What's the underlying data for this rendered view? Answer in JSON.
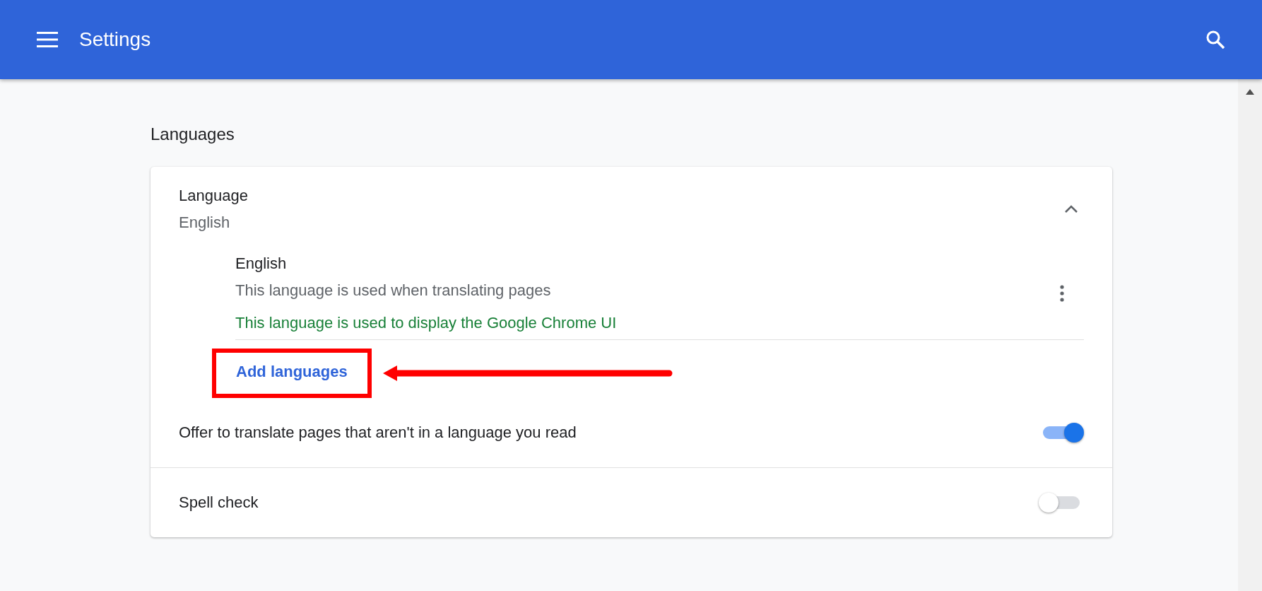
{
  "header": {
    "title": "Settings"
  },
  "section_title": "Languages",
  "language": {
    "label": "Language",
    "value": "English",
    "expanded": true,
    "items": [
      {
        "name": "English",
        "lines": [
          "This language is used when translating pages"
        ],
        "ui_note": "This language is used to display the Google Chrome UI"
      }
    ]
  },
  "add_languages": {
    "label": "Add languages"
  },
  "settings": [
    {
      "label": "Offer to translate pages that aren't in a language you read",
      "on": true
    },
    {
      "label": "Spell check",
      "on": false
    }
  ]
}
